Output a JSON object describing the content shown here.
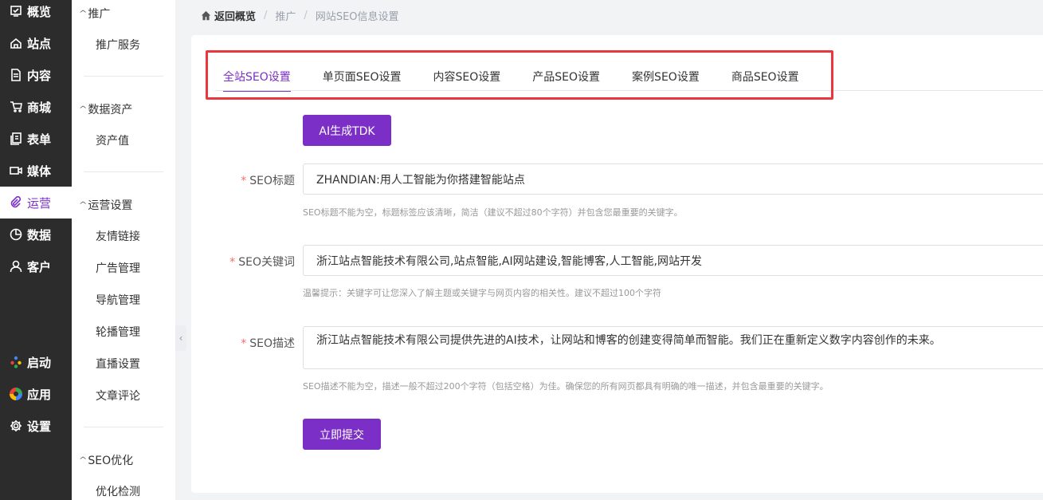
{
  "rail": {
    "items": [
      {
        "label": "概览",
        "icon": "overview-icon"
      },
      {
        "label": "站点",
        "icon": "home-icon"
      },
      {
        "label": "内容",
        "icon": "document-icon"
      },
      {
        "label": "商城",
        "icon": "cart-icon"
      },
      {
        "label": "表单",
        "icon": "form-icon"
      },
      {
        "label": "媒体",
        "icon": "video-icon"
      },
      {
        "label": "运营",
        "icon": "paperclip-icon",
        "active": true
      },
      {
        "label": "数据",
        "icon": "pie-chart-icon"
      },
      {
        "label": "客户",
        "icon": "user-icon"
      }
    ],
    "bottom": [
      {
        "label": "启动",
        "icon": "launch-icon"
      },
      {
        "label": "应用",
        "icon": "apps-icon"
      },
      {
        "label": "设置",
        "icon": "gear-icon"
      }
    ]
  },
  "submenu": {
    "groups": [
      {
        "title": "推广",
        "items": [
          "推广服务"
        ]
      },
      {
        "title": "数据资产",
        "items": [
          "资产值"
        ]
      },
      {
        "title": "运营设置",
        "items": [
          "友情链接",
          "广告管理",
          "导航管理",
          "轮播管理",
          "直播设置",
          "文章评论"
        ]
      },
      {
        "title": "SEO优化",
        "items": [
          "优化检测"
        ]
      }
    ]
  },
  "breadcrumb": {
    "back": "返回概览",
    "level1": "推广",
    "level2": "网站SEO信息设置"
  },
  "tabs": [
    "全站SEO设置",
    "单页面SEO设置",
    "内容SEO设置",
    "产品SEO设置",
    "案例SEO设置",
    "商品SEO设置"
  ],
  "form": {
    "ai_button": "AI生成TDK",
    "title": {
      "label": "SEO标题",
      "value": "ZHANDIAN:用人工智能为你搭建智能站点",
      "hint": "SEO标题不能为空，标题标签应该清晰，简洁（建议不超过80个字符）并包含您最重要的关键字。"
    },
    "keywords": {
      "label": "SEO关键词",
      "value": "浙江站点智能技术有限公司,站点智能,AI网站建设,智能博客,人工智能,网站开发",
      "hint": "温馨提示：关键字可让您深入了解主题或关键字与网页内容的相关性。建议不超过100个字符"
    },
    "description": {
      "label": "SEO描述",
      "value": "浙江站点智能技术有限公司提供先进的AI技术，让网站和博客的创建变得简单而智能。我们正在重新定义数字内容创作的未来。",
      "hint": "SEO描述不能为空，描述一般不超过200个字符（包括空格）为佳。确保您的所有网页都具有明确的唯一描述，并包含最重要的关键字。"
    },
    "required_mark": "*",
    "submit": "立即提交"
  },
  "colors": {
    "accent": "#7b2fc6",
    "highlight_box": "#e8373d",
    "rail_bg": "#2c2c2c"
  }
}
